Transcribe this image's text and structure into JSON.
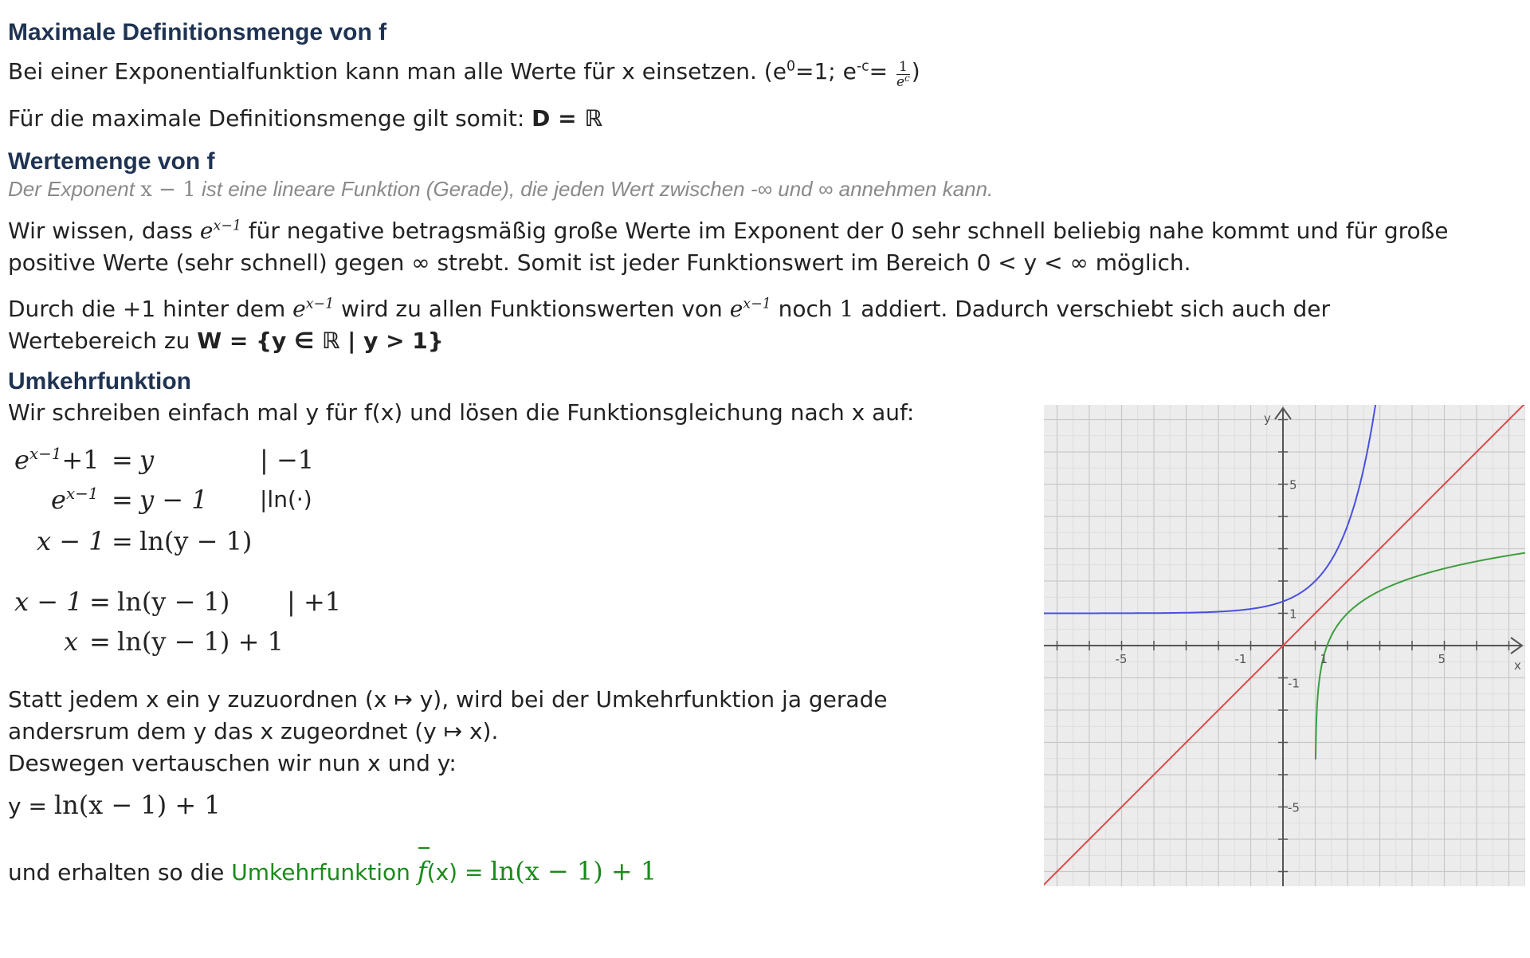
{
  "sections": {
    "def_heading": "Maximale Definitionsmenge von f",
    "def_line1_text": "Bei einer Exponentialfunktion kann man alle Werte für x einsetzen. (e",
    "def_line1_sup0": "0",
    "def_line1_mid": "=1; e",
    "def_line1_supc": "-c",
    "def_line1_eq": "=",
    "def_frac_num": "1",
    "def_frac_den": "e",
    "def_frac_den_sup": "c",
    "def_line1_close": ")",
    "def_line2_text": "Für die maximale Definitionsmenge gilt somit: ",
    "def_line2_bold": "D = ℝ",
    "wert_heading": "Wertemenge von f",
    "wert_note_a": "Der Exponent ",
    "wert_note_math": "x − 1",
    "wert_note_b": " ist eine lineare Funktion (Gerade), die jeden Wert zwischen -∞ und ∞ annehmen kann.",
    "wert_p1_a": "Wir wissen, dass ",
    "wert_p1_b": " für negative betragsmäßig große Werte im Exponent der 0 sehr schnell beliebig nahe kommt und für große",
    "wert_p1_line2": "positive Werte (sehr schnell) gegen ∞ strebt. Somit ist jeder Funktionswert im Bereich 0 < y < ∞ möglich.",
    "wert_p2_a": "Durch die +1 hinter dem ",
    "wert_p2_b": " wird zu allen Funktionswerten von ",
    "wert_p2_c": " noch ",
    "wert_p2_one": "1",
    "wert_p2_d": " addiert. Dadurch verschiebt sich auch der",
    "wert_p2_line2": "Wertebereich zu ",
    "wert_p2_bold": "W = {y ∈ ℝ  | y > 1}",
    "exp_base": "e",
    "exp_sup": "x−1",
    "umk_heading": "Umkehrfunktion",
    "umk_intro": "Wir schreiben einfach mal y für f(x) und lösen die Funktionsgleichung nach x auf:",
    "eq": {
      "r1_base": "e",
      "r1_sup": "x−1",
      "r1_plus": "+1",
      "r1_eq": "=",
      "r1_rhs": "y",
      "r1_op": "| −1",
      "r2_base": "e",
      "r2_sup": "x−1",
      "r2_eq": "=",
      "r2_rhs": "y − 1",
      "r2_op": "|ln(·)",
      "r3_lhs": "x − 1",
      "r3_eq": "=",
      "r3_rhs": "ln(y − 1)",
      "r4_lhs": "x − 1",
      "r4_eq": "=",
      "r4_rhs": "ln(y − 1)",
      "r4_op": "| +1",
      "r5_lhs": "x",
      "r5_eq": "=",
      "r5_rhs": "ln(y − 1) + 1"
    },
    "swap_line1": "Statt jedem x ein y zuzuordnen (x ↦ y), wird bei der Umkehrfunktion ja gerade",
    "swap_line2": "andersrum dem y das x zugeordnet (y ↦ x).",
    "swap_line3": "Deswegen vertauschen wir nun x und y:",
    "result_lhs": "y = ",
    "result_rhs": "ln(x − 1) + 1",
    "final_a": "und erhalten so die ",
    "final_green": "Umkehrfunktion ",
    "final_f": "f",
    "final_fx": "(x) = ",
    "final_rhs": "ln(x − 1) + 1"
  },
  "graph": {
    "axis_label_x": "x",
    "axis_label_y": "y",
    "tick_labels": [
      {
        "text": "-5",
        "axis": "x",
        "value": -5
      },
      {
        "text": "-1",
        "axis": "x",
        "value": -1
      },
      {
        "text": "1",
        "axis": "x",
        "value": 1
      },
      {
        "text": "5",
        "axis": "x",
        "value": 5
      },
      {
        "text": "5",
        "axis": "y",
        "value": 5
      },
      {
        "text": "1",
        "axis": "y",
        "value": 1
      },
      {
        "text": "-1",
        "axis": "y",
        "value": -1
      },
      {
        "text": "-5",
        "axis": "y",
        "value": -5
      }
    ],
    "xlim": [
      -7.5,
      7.5
    ],
    "ylim": [
      -7.5,
      7.5
    ],
    "grid": true,
    "curves": [
      {
        "function": "e^(x−1)+1",
        "color": "#4a4fe0"
      },
      {
        "function": "ln(x−1)+1",
        "color": "#3e9e3e"
      },
      {
        "function": "y = x",
        "color": "#e04848"
      }
    ]
  }
}
